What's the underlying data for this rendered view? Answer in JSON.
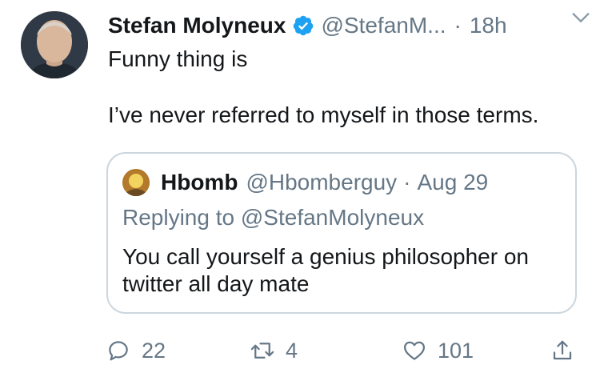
{
  "tweet": {
    "author_name": "Stefan Molyneux",
    "author_handle": "@StefanM...",
    "separator": "·",
    "time": "18h",
    "text_line1": "Funny thing is",
    "text_line2": "I’ve never referred to myself in those terms."
  },
  "quote": {
    "author_name": "Hbomb",
    "author_handle": "@Hbomberguy",
    "separator": "·",
    "date": "Aug 29",
    "reply_prefix": "Replying to",
    "reply_mention": "@StefanMolyneux",
    "text": "You call yourself a genius philosopher on twitter all day mate"
  },
  "actions": {
    "reply_count": "22",
    "retweet_count": "4",
    "like_count": "101"
  },
  "icons": {
    "verified": "verified-badge-icon",
    "more": "chevron-down-icon",
    "reply": "reply-icon",
    "retweet": "retweet-icon",
    "like": "heart-icon",
    "share": "share-icon"
  },
  "colors": {
    "verified_blue": "#1da1f2",
    "secondary_text": "#657786",
    "primary_text": "#14171a",
    "border": "#ccd6dd"
  }
}
